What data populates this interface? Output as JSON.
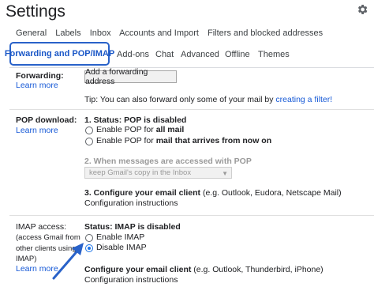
{
  "header": {
    "title": "Settings",
    "settings_icon": "gear-icon"
  },
  "tabs": {
    "row1": [
      "General",
      "Labels",
      "Inbox",
      "Accounts and Import",
      "Filters and blocked addresses"
    ],
    "active": "Forwarding and POP/IMAP",
    "row2": [
      "Add-ons",
      "Chat",
      "Advanced",
      "Offline",
      "Themes"
    ],
    "active_color": "#2962c9"
  },
  "forwarding": {
    "label": "Forwarding:",
    "learn_more": "Learn more",
    "button": "Add a forwarding address",
    "tip_prefix": "Tip: You can also forward only some of your mail by ",
    "tip_link": "creating a filter!"
  },
  "pop": {
    "label": "POP download:",
    "learn_more": "Learn more",
    "status": "1. Status: POP is disabled",
    "opt1_prefix": "Enable POP for ",
    "opt1_bold": "all mail",
    "opt2_prefix": "Enable POP for ",
    "opt2_bold": "mail that arrives from now on",
    "when_accessed": "2. When messages are accessed with POP",
    "select_value": "keep Gmail's copy in the Inbox",
    "configure": "3. Configure your email client",
    "configure_note": " (e.g. Outlook, Eudora, Netscape Mail)",
    "configure_link": "Configuration instructions"
  },
  "imap": {
    "label": "IMAP access:",
    "note": [
      "(access Gmail from",
      "other clients using",
      "IMAP)"
    ],
    "learn_more": "Learn more",
    "status": "Status: IMAP is disabled",
    "enable": "Enable IMAP",
    "disable": "Disable IMAP",
    "selected": "disable",
    "configure": "Configure your email client",
    "configure_note": " (e.g. Outlook, Thunderbird, iPhone)",
    "configure_link": "Configuration instructions",
    "arrow_color": "#2962c9"
  }
}
